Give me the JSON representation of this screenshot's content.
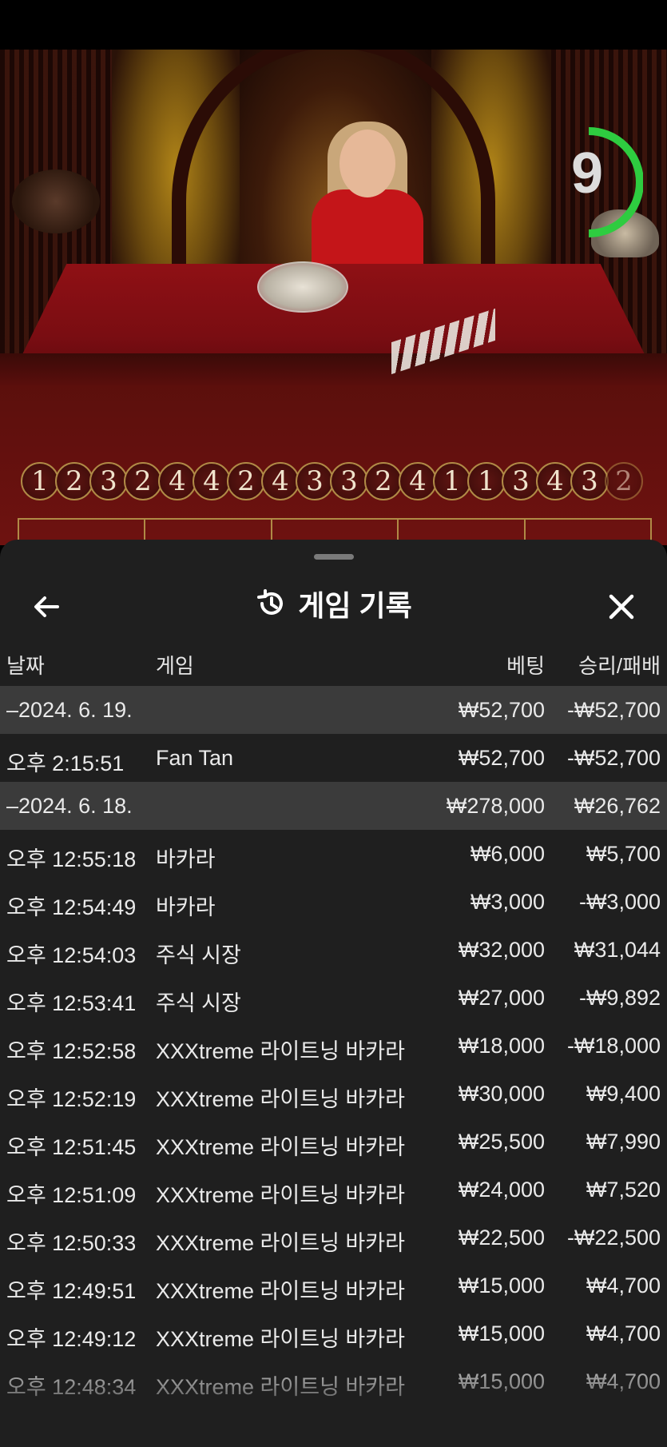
{
  "timer": {
    "value": "9",
    "color": "#2ecc40"
  },
  "result_history": [
    "1",
    "2",
    "3",
    "2",
    "4",
    "4",
    "2",
    "4",
    "3",
    "3",
    "2",
    "4",
    "1",
    "1",
    "3",
    "4",
    "3",
    "2"
  ],
  "sheet": {
    "title": "게임 기록",
    "back_icon": "arrow-left-icon",
    "history_icon": "history-icon",
    "close_icon": "close-icon"
  },
  "columns": {
    "date": "날짜",
    "game": "게임",
    "bet": "베팅",
    "win_loss": "승리/패배"
  },
  "rows": [
    {
      "type": "date",
      "time": "–2024. 6. 19.",
      "game": "",
      "bet": "₩52,700",
      "win": "-₩52,700"
    },
    {
      "type": "item",
      "time": "오후 2:15:51",
      "game": "Fan Tan",
      "bet": "₩52,700",
      "win": "-₩52,700"
    },
    {
      "type": "date",
      "time": "–2024. 6. 18.",
      "game": "",
      "bet": "₩278,000",
      "win": "₩26,762"
    },
    {
      "type": "item",
      "time": "오후 12:55:18",
      "game": "바카라",
      "bet": "₩6,000",
      "win": "₩5,700"
    },
    {
      "type": "item",
      "time": "오후 12:54:49",
      "game": "바카라",
      "bet": "₩3,000",
      "win": "-₩3,000"
    },
    {
      "type": "item",
      "time": "오후 12:54:03",
      "game": "주식 시장",
      "bet": "₩32,000",
      "win": "₩31,044"
    },
    {
      "type": "item",
      "time": "오후 12:53:41",
      "game": "주식 시장",
      "bet": "₩27,000",
      "win": "-₩9,892"
    },
    {
      "type": "item",
      "time": "오후 12:52:58",
      "game": "XXXtreme 라이트닝 바카라",
      "bet": "₩18,000",
      "win": "-₩18,000"
    },
    {
      "type": "item",
      "time": "오후 12:52:19",
      "game": "XXXtreme 라이트닝 바카라",
      "bet": "₩30,000",
      "win": "₩9,400"
    },
    {
      "type": "item",
      "time": "오후 12:51:45",
      "game": "XXXtreme 라이트닝 바카라",
      "bet": "₩25,500",
      "win": "₩7,990"
    },
    {
      "type": "item",
      "time": "오후 12:51:09",
      "game": "XXXtreme 라이트닝 바카라",
      "bet": "₩24,000",
      "win": "₩7,520"
    },
    {
      "type": "item",
      "time": "오후 12:50:33",
      "game": "XXXtreme 라이트닝 바카라",
      "bet": "₩22,500",
      "win": "-₩22,500"
    },
    {
      "type": "item",
      "time": "오후 12:49:51",
      "game": "XXXtreme 라이트닝 바카라",
      "bet": "₩15,000",
      "win": "₩4,700"
    },
    {
      "type": "item",
      "time": "오후 12:49:12",
      "game": "XXXtreme 라이트닝 바카라",
      "bet": "₩15,000",
      "win": "₩4,700"
    },
    {
      "type": "item",
      "time": "오후 12:48:34",
      "game": "XXXtreme 라이트닝 바카라",
      "bet": "₩15,000",
      "win": "₩4,700"
    }
  ]
}
